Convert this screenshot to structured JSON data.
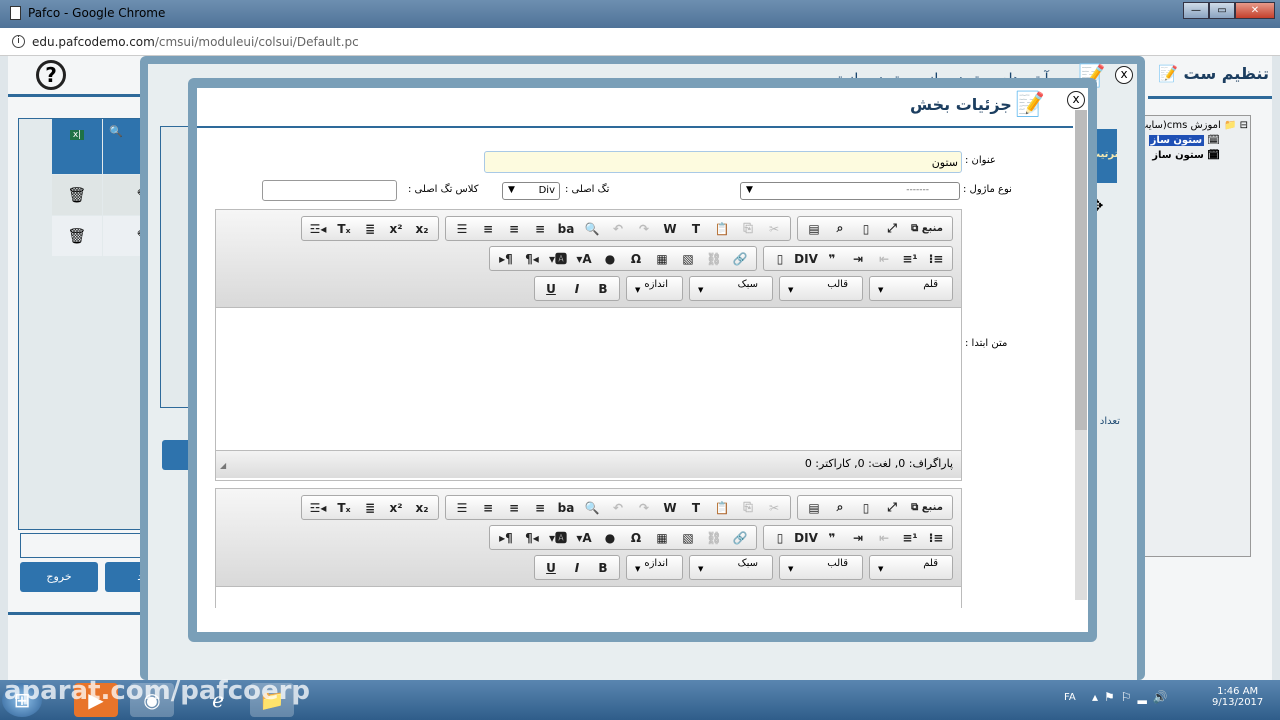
{
  "window": {
    "title": "Pafco - Google Chrome",
    "controls": [
      "—",
      "▭",
      "✕"
    ]
  },
  "address": {
    "domain": "edu.pafcodemo.com",
    "path": "/cmsui/moduleui/colsui/Default.pc"
  },
  "background_page": {
    "help_glyph": "?",
    "header_title": "تنظیم ست",
    "tree": {
      "root": "اموزش cms(سایت",
      "items": [
        "ستون ساز",
        "ستون ساز"
      ]
    },
    "grid_header_partial": "ترتیب",
    "count_partial": "تعداد ر",
    "exit_button": "خروج",
    "new_button_partial": "دید",
    "confirm_partial": "ج"
  },
  "dialog_outer": {
    "title": "آیتم های ستون ساز - ستون ساز تست",
    "close": "x"
  },
  "dialog": {
    "title": "جزئیات بخش",
    "close": "x",
    "fields": {
      "title_label": "عنوان :",
      "title_value": "ستون",
      "module_type_label": "نوع ماژول :",
      "module_type_value": "-------",
      "main_tag_label": "تگ اصلی :",
      "main_tag_value": "Div",
      "main_tag_class_label": "کلاس تگ اصلی :",
      "main_tag_class_value": "",
      "start_text_label": "متن ابتدا :"
    },
    "status_text": "پاراگراف: 0, لغت: 0, کاراکتر: 0"
  },
  "editor_toolbar": {
    "row1": [
      [
        {
          "n": "source",
          "g": "⧉ منبع"
        },
        {
          "n": "maximize",
          "g": "⤢"
        },
        {
          "n": "template",
          "g": "▯"
        },
        {
          "n": "preview",
          "g": "⌕"
        },
        {
          "n": "new-page",
          "g": "▤"
        }
      ],
      [
        {
          "n": "cut",
          "g": "✂",
          "d": true
        },
        {
          "n": "copy",
          "g": "⎘",
          "d": true
        },
        {
          "n": "paste",
          "g": "📋"
        },
        {
          "n": "paste-text",
          "g": "T"
        },
        {
          "n": "paste-word",
          "g": "W"
        },
        {
          "n": "redo",
          "g": "↷",
          "d": true
        },
        {
          "n": "undo",
          "g": "↶",
          "d": true
        },
        {
          "n": "find",
          "g": "🔍"
        },
        {
          "n": "replace",
          "g": "ba"
        },
        {
          "n": "align-left",
          "g": "≡"
        },
        {
          "n": "align-center",
          "g": "≡"
        },
        {
          "n": "align-right",
          "g": "≡"
        },
        {
          "n": "justify",
          "g": "☰"
        }
      ],
      [
        {
          "n": "subscript",
          "g": "x₂"
        },
        {
          "n": "superscript",
          "g": "x²"
        },
        {
          "n": "horizontal-rule",
          "g": "≣"
        },
        {
          "n": "remove-format",
          "g": "Tₓ"
        },
        {
          "n": "insert-special",
          "g": "☲◂"
        }
      ]
    ],
    "row2": [
      [
        {
          "n": "bulleted-list",
          "g": "⁝≡"
        },
        {
          "n": "numbered-list",
          "g": "≡¹"
        },
        {
          "n": "outdent",
          "g": "⇤",
          "d": true
        },
        {
          "n": "indent",
          "g": "⇥"
        },
        {
          "n": "blockquote",
          "g": "❞"
        },
        {
          "n": "div",
          "g": "DIV"
        },
        {
          "n": "iframe",
          "g": "▯"
        }
      ],
      [
        {
          "n": "link",
          "g": "🔗"
        },
        {
          "n": "unlink",
          "g": "⛓",
          "d": true
        },
        {
          "n": "image",
          "g": "▧"
        },
        {
          "n": "table",
          "g": "▦"
        },
        {
          "n": "special-char",
          "g": "Ω"
        },
        {
          "n": "flash",
          "g": "●"
        },
        {
          "n": "text-color",
          "g": "▾A"
        },
        {
          "n": "bg-color",
          "g": "▾🅰"
        },
        {
          "n": "rtl",
          "g": "¶◂"
        },
        {
          "n": "ltr",
          "g": "▸¶"
        }
      ]
    ],
    "combos": [
      "قلم",
      "قالب",
      "سبک",
      "اندازه"
    ],
    "format": [
      {
        "n": "bold",
        "g": "B"
      },
      {
        "n": "italic",
        "g": "I"
      },
      {
        "n": "underline",
        "g": "U"
      }
    ]
  },
  "taskbar": {
    "watermark": "aparat.com/pafcoerp",
    "lang": "FA",
    "time": "1:46 AM",
    "date": "9/13/2017"
  }
}
